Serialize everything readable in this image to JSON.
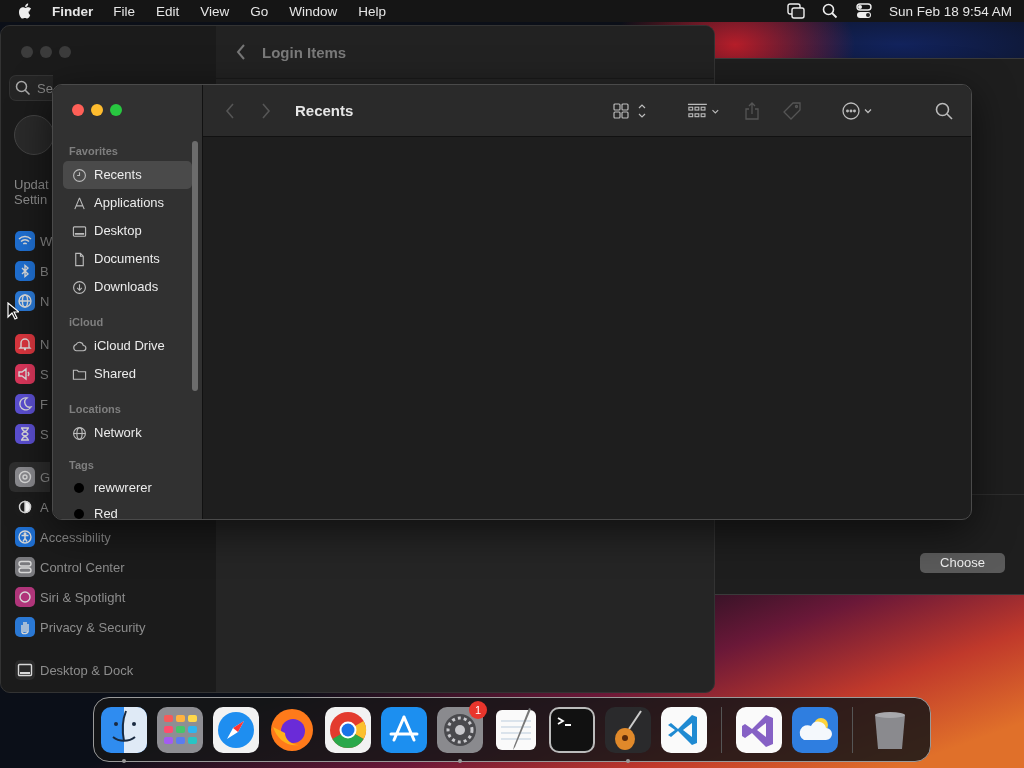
{
  "menu_bar": {
    "app": "Finder",
    "menus": [
      "File",
      "Edit",
      "View",
      "Go",
      "Window",
      "Help"
    ],
    "clock": "Sun Feb 18  9:54 AM"
  },
  "settings_window": {
    "search": {
      "placeholder": "Se"
    },
    "account_lines": [
      "Updat",
      "Settin"
    ],
    "sidebar": [
      [
        {
          "label": "W",
          "kind": "wifi",
          "color": "#1f6fd1",
          "selected": false
        },
        {
          "label": "B",
          "kind": "bluetooth",
          "color": "#1f6fd1",
          "selected": false
        },
        {
          "label": "N",
          "kind": "globe",
          "color": "#2a78d4",
          "selected": false
        }
      ],
      [
        {
          "label": "N",
          "kind": "bell",
          "color": "#d9363e",
          "selected": false
        },
        {
          "label": "S",
          "kind": "speaker",
          "color": "#d9365a",
          "selected": false
        },
        {
          "label": "F",
          "kind": "moon",
          "color": "#5b4fd1",
          "selected": false
        },
        {
          "label": "S",
          "kind": "hourglass",
          "color": "#5b4fd1",
          "selected": false
        }
      ],
      [
        {
          "label": "G",
          "kind": "gear",
          "color": "#8a8a8e",
          "selected": true
        },
        {
          "label": "A",
          "kind": "contrast",
          "color": "#1c1c1c",
          "selected": false
        },
        {
          "label": "Accessibility",
          "kind": "accessibility",
          "color": "#1f6fd1",
          "selected": false
        },
        {
          "label": "Control Center",
          "kind": "toggles",
          "color": "#7a7a7e",
          "selected": false
        },
        {
          "label": "Siri & Spotlight",
          "kind": "orb",
          "color": "#b0357a",
          "selected": false
        },
        {
          "label": "Privacy & Security",
          "kind": "hand",
          "color": "#2a78d4",
          "selected": false
        }
      ],
      [
        {
          "label": "Desktop & Dock",
          "kind": "dock",
          "color": "#2a2a2a",
          "selected": false
        }
      ]
    ],
    "header": {
      "title": "Login Items"
    }
  },
  "open_panel": {
    "buttons": [
      "Choose"
    ]
  },
  "finder": {
    "title": "Recents",
    "sidebar": [
      {
        "heading": "Favorites",
        "items": [
          {
            "label": "Recents",
            "kind": "clock",
            "selected": true
          },
          {
            "label": "Applications",
            "kind": "apps",
            "selected": false
          },
          {
            "label": "Desktop",
            "kind": "desktop",
            "selected": false
          },
          {
            "label": "Documents",
            "kind": "document",
            "selected": false
          },
          {
            "label": "Downloads",
            "kind": "download",
            "selected": false
          }
        ]
      },
      {
        "heading": "iCloud",
        "items": [
          {
            "label": "iCloud Drive",
            "kind": "cloud",
            "selected": false
          },
          {
            "label": "Shared",
            "kind": "shared",
            "selected": false
          }
        ]
      },
      {
        "heading": "Locations",
        "items": [
          {
            "label": "Network",
            "kind": "globe",
            "selected": false
          }
        ]
      },
      {
        "heading": "Tags",
        "items": [
          {
            "label": "rewwrerer",
            "kind": "tag",
            "color": "#000000",
            "selected": false
          },
          {
            "label": "Red",
            "kind": "tag",
            "color": "#000000",
            "selected": false
          }
        ]
      }
    ]
  },
  "dock": [
    {
      "kind": "finder",
      "running": true
    },
    {
      "kind": "launchpad",
      "running": false
    },
    {
      "kind": "safari",
      "running": false
    },
    {
      "kind": "firefox",
      "running": false
    },
    {
      "kind": "chrome",
      "running": false
    },
    {
      "kind": "appstore",
      "running": false
    },
    {
      "kind": "settings",
      "running": true,
      "badge": "1"
    },
    {
      "kind": "textedit",
      "running": false
    },
    {
      "kind": "terminal",
      "running": false
    },
    {
      "kind": "garageband",
      "running": true
    },
    {
      "kind": "vscode",
      "running": false
    },
    {
      "kind": "separator"
    },
    {
      "kind": "visualstudio",
      "running": false
    },
    {
      "kind": "weather",
      "running": false
    },
    {
      "kind": "separator"
    },
    {
      "kind": "trash",
      "running": false
    }
  ]
}
